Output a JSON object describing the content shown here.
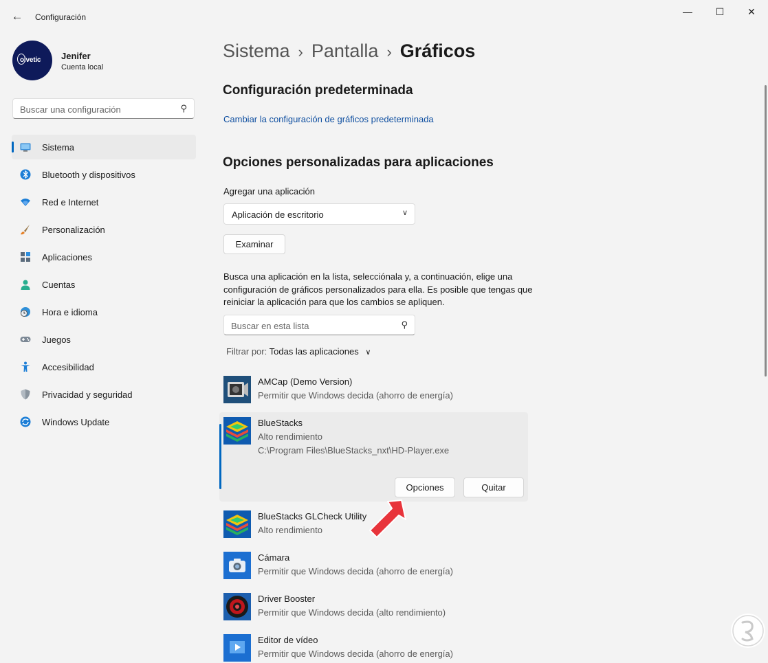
{
  "window": {
    "title": "Configuración",
    "back_icon": "back-arrow-icon",
    "controls": [
      "minimize",
      "maximize",
      "close"
    ]
  },
  "user": {
    "name": "Jenifer",
    "account": "Cuenta local",
    "avatar_text": "olvetic"
  },
  "search": {
    "placeholder": "Buscar una configuración"
  },
  "sidebar": {
    "items": [
      {
        "label": "Sistema",
        "icon": "monitor-icon",
        "active": true
      },
      {
        "label": "Bluetooth y dispositivos",
        "icon": "bluetooth-icon"
      },
      {
        "label": "Red e Internet",
        "icon": "wifi-icon"
      },
      {
        "label": "Personalización",
        "icon": "brush-icon"
      },
      {
        "label": "Aplicaciones",
        "icon": "apps-icon"
      },
      {
        "label": "Cuentas",
        "icon": "person-icon"
      },
      {
        "label": "Hora e idioma",
        "icon": "globe-clock-icon"
      },
      {
        "label": "Juegos",
        "icon": "gamepad-icon"
      },
      {
        "label": "Accesibilidad",
        "icon": "accessibility-icon"
      },
      {
        "label": "Privacidad y seguridad",
        "icon": "shield-icon"
      },
      {
        "label": "Windows Update",
        "icon": "update-icon"
      }
    ]
  },
  "breadcrumb": {
    "items": [
      "Sistema",
      "Pantalla",
      "Gráficos"
    ],
    "separator": "›"
  },
  "default_section": {
    "title": "Configuración predeterminada",
    "link": "Cambiar la configuración de gráficos predeterminada"
  },
  "custom_section": {
    "title": "Opciones personalizadas para aplicaciones",
    "add_label": "Agregar una aplicación",
    "dropdown_value": "Aplicación de escritorio",
    "browse_button": "Examinar",
    "description": "Busca una aplicación en la lista, selecciónala y, a continuación, elige una configuración de gráficos personalizados para ella. Es posible que tengas que reiniciar la aplicación para que los cambios se apliquen.",
    "list_search_placeholder": "Buscar en esta lista",
    "filter_label": "Filtrar por:",
    "filter_value": "Todas las aplicaciones"
  },
  "apps": [
    {
      "name": "AMCap (Demo Version)",
      "setting": "Permitir que Windows decida (ahorro de energía)",
      "icon": "camcorder-icon"
    },
    {
      "name": "BlueStacks",
      "setting": "Alto rendimiento",
      "path": "C:\\Program Files\\BlueStacks_nxt\\HD-Player.exe",
      "icon": "bluestacks-icon",
      "expanded": true,
      "options_button": "Opciones",
      "remove_button": "Quitar"
    },
    {
      "name": "BlueStacks GLCheck Utility",
      "setting": "Alto rendimiento",
      "icon": "bluestacks-icon"
    },
    {
      "name": "Cámara",
      "setting": "Permitir que Windows decida (ahorro de energía)",
      "icon": "camera-icon"
    },
    {
      "name": "Driver Booster",
      "setting": "Permitir que Windows decida (alto rendimiento)",
      "icon": "driver-booster-icon"
    },
    {
      "name": "Editor de vídeo",
      "setting": "Permitir que Windows decida (ahorro de energía)",
      "icon": "video-editor-icon"
    }
  ],
  "colors": {
    "accent": "#0067c0",
    "link": "#0f4fa0",
    "background": "#f3f3f3",
    "arrow": "#e8343b"
  }
}
